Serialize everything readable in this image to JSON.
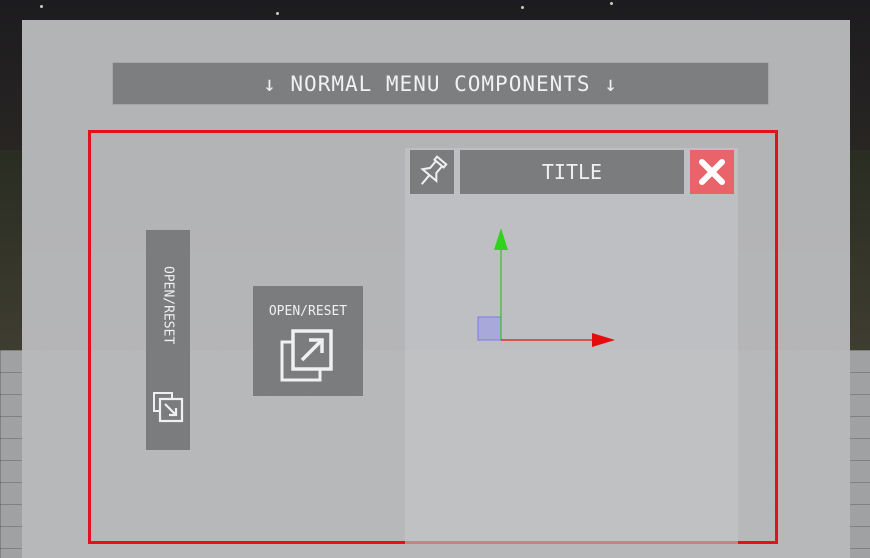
{
  "banner": {
    "text": "↓ NORMAL MENU COMPONENTS ↓"
  },
  "open_reset_vertical": {
    "label": "OPEN/RESET",
    "icon": "open-reset-icon"
  },
  "open_reset_square": {
    "label": "OPEN/RESET",
    "icon": "open-reset-icon"
  },
  "window": {
    "title": "TITLE",
    "pin_icon": "pin-icon",
    "close_icon": "close-icon",
    "close_color": "#e9636b"
  },
  "colors": {
    "highlight_frame": "#e3101d",
    "button_bg": "#7b7c7e",
    "axis_x": "#e01010",
    "axis_y": "#2ec41a",
    "axis_origin": "#8a8ef0"
  }
}
